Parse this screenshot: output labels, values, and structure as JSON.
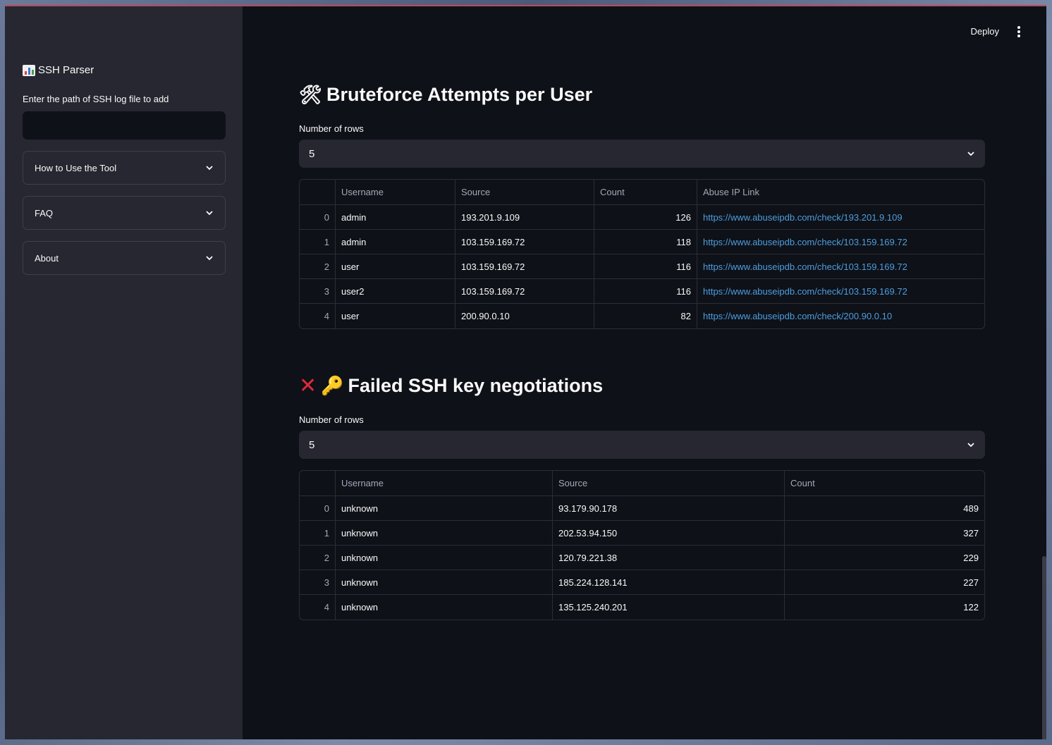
{
  "sidebar": {
    "title": "SSH Parser",
    "input_label": "Enter the path of SSH log file to add",
    "input_value": "",
    "expanders": [
      {
        "label": "How to Use the Tool"
      },
      {
        "label": "FAQ"
      },
      {
        "label": "About"
      }
    ]
  },
  "header": {
    "deploy_label": "Deploy"
  },
  "bruteforce": {
    "title": "Bruteforce Attempts per User",
    "rows_label": "Number of rows",
    "rows_value": "5",
    "columns": [
      "Username",
      "Source",
      "Count",
      "Abuse IP Link"
    ],
    "rows": [
      {
        "idx": "0",
        "username": "admin",
        "source": "193.201.9.109",
        "count": "126",
        "link": "https://www.abuseipdb.com/check/193.201.9.109"
      },
      {
        "idx": "1",
        "username": "admin",
        "source": "103.159.169.72",
        "count": "118",
        "link": "https://www.abuseipdb.com/check/103.159.169.72"
      },
      {
        "idx": "2",
        "username": "user",
        "source": "103.159.169.72",
        "count": "116",
        "link": "https://www.abuseipdb.com/check/103.159.169.72"
      },
      {
        "idx": "3",
        "username": "user2",
        "source": "103.159.169.72",
        "count": "116",
        "link": "https://www.abuseipdb.com/check/103.159.169.72"
      },
      {
        "idx": "4",
        "username": "user",
        "source": "200.90.0.10",
        "count": "82",
        "link": "https://www.abuseipdb.com/check/200.90.0.10"
      }
    ]
  },
  "failed_keys": {
    "title": "Failed SSH key negotiations",
    "rows_label": "Number of rows",
    "rows_value": "5",
    "columns": [
      "Username",
      "Source",
      "Count"
    ],
    "rows": [
      {
        "idx": "0",
        "username": "unknown",
        "source": "93.179.90.178",
        "count": "489"
      },
      {
        "idx": "1",
        "username": "unknown",
        "source": "202.53.94.150",
        "count": "327"
      },
      {
        "idx": "2",
        "username": "unknown",
        "source": "120.79.221.38",
        "count": "229"
      },
      {
        "idx": "3",
        "username": "unknown",
        "source": "185.224.128.141",
        "count": "227"
      },
      {
        "idx": "4",
        "username": "unknown",
        "source": "135.125.240.201",
        "count": "122"
      }
    ]
  },
  "icons": {
    "sidebar_title": "bar-chart-icon",
    "bruteforce_title": "hammer-wrench-icon",
    "failed_title": [
      "cross-mark-icon",
      "key-icon"
    ]
  },
  "colors": {
    "background": "#0e1117",
    "sidebar": "#262730",
    "link": "#4d9de0"
  }
}
